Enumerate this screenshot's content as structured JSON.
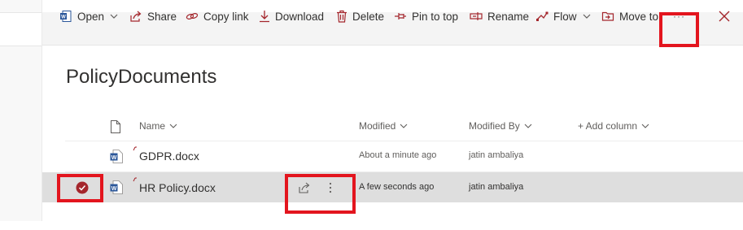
{
  "toolbar": {
    "open": "Open",
    "share": "Share",
    "copy_link": "Copy link",
    "download": "Download",
    "delete": "Delete",
    "pin_to_top": "Pin to top",
    "rename": "Rename",
    "flow": "Flow",
    "move_to": "Move to",
    "more": "···",
    "selected_count": "1"
  },
  "library": {
    "title": "PolicyDocuments"
  },
  "columns": {
    "name": "Name",
    "modified": "Modified",
    "modified_by": "Modified By",
    "add_column": "+ Add column"
  },
  "files": [
    {
      "name": "GDPR.docx",
      "modified": "About a minute ago",
      "modified_by": "jatin ambaliya",
      "selected": false
    },
    {
      "name": "HR Policy.docx",
      "modified": "A few seconds ago",
      "modified_by": "jatin ambaliya",
      "selected": true
    }
  ],
  "colors": {
    "accent": "#a4262c",
    "highlight_box": "#e3151e",
    "word_blue": "#2b579a",
    "selected_row": "#dedede"
  }
}
